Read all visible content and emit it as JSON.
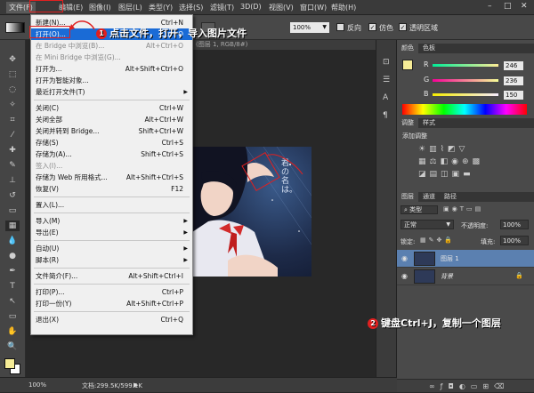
{
  "menubar": {
    "items": [
      "文件(F)",
      "编辑(E)",
      "图像(I)",
      "图层(L)",
      "类型(Y)",
      "选择(S)",
      "滤镜(T)",
      "3D(D)",
      "视图(V)",
      "窗口(W)",
      "帮助(H)"
    ],
    "window_controls": [
      "–",
      "□",
      "✕"
    ]
  },
  "options": {
    "opacity_value": "100%",
    "reverse_label": "反向",
    "dither_label": "仿色",
    "transparency_label": "透明区域"
  },
  "file_menu": {
    "items": [
      {
        "label": "新建(N)...",
        "shortcut": "Ctrl+N"
      },
      {
        "label": "打开(O)...",
        "shortcut": "Ctrl+O"
      },
      {
        "label": "在 Bridge 中浏览(B)...",
        "shortcut": "Alt+Ctrl+O"
      },
      {
        "label": "在 Mini Bridge 中浏览(G)...",
        "shortcut": ""
      },
      {
        "label": "打开为...",
        "shortcut": "Alt+Shift+Ctrl+O"
      },
      {
        "label": "打开为智能对象...",
        "shortcut": ""
      },
      {
        "label": "最近打开文件(T)",
        "shortcut": ""
      },
      {
        "label": "关闭(C)",
        "shortcut": "Ctrl+W"
      },
      {
        "label": "关闭全部",
        "shortcut": "Alt+Ctrl+W"
      },
      {
        "label": "关闭并转到 Bridge...",
        "shortcut": "Shift+Ctrl+W"
      },
      {
        "label": "存储(S)",
        "shortcut": "Ctrl+S"
      },
      {
        "label": "存储为(A)...",
        "shortcut": "Shift+Ctrl+S"
      },
      {
        "label": "签入(I)...",
        "shortcut": ""
      },
      {
        "label": "存储为 Web 所用格式...",
        "shortcut": "Alt+Shift+Ctrl+S"
      },
      {
        "label": "恢复(V)",
        "shortcut": "F12"
      },
      {
        "label": "置入(L)...",
        "shortcut": ""
      },
      {
        "label": "导入(M)",
        "shortcut": ""
      },
      {
        "label": "导出(E)",
        "shortcut": ""
      },
      {
        "label": "自动(U)",
        "shortcut": ""
      },
      {
        "label": "脚本(R)",
        "shortcut": ""
      },
      {
        "label": "文件简介(F)...",
        "shortcut": "Alt+Shift+Ctrl+I"
      },
      {
        "label": "打印(P)...",
        "shortcut": "Ctrl+P"
      },
      {
        "label": "打印一份(Y)",
        "shortcut": "Alt+Shift+Ctrl+P"
      },
      {
        "label": "退出(X)",
        "shortcut": "Ctrl+Q"
      }
    ]
  },
  "document": {
    "tab_title": "(图层 1, RGB/8#)",
    "canvas_text": "君の名は。"
  },
  "status": {
    "zoom": "100%",
    "doc_size": "文档:299.5K/599.1K"
  },
  "color_panel": {
    "tabs": [
      "颜色",
      "色板"
    ],
    "r_label": "R",
    "g_label": "G",
    "b_label": "B",
    "r_value": "246",
    "g_value": "236",
    "b_value": "150",
    "swatch_color": "#f6ec96"
  },
  "adjust_panel": {
    "tabs": [
      "调整",
      "样式"
    ],
    "title": "添加调整"
  },
  "layers_panel": {
    "tabs": [
      "图层",
      "通道",
      "路径"
    ],
    "kind_label": "类型",
    "blend_mode": "正常",
    "opacity_label": "不透明度:",
    "opacity_value": "100%",
    "lock_label": "锁定:",
    "fill_label": "填充:",
    "fill_value": "100%",
    "layers": [
      {
        "name": "图层 1"
      },
      {
        "name": "背景"
      }
    ]
  },
  "annotations": {
    "step1_num": "1",
    "step1_text": "点击文件，打开，导入图片文件",
    "step2_num": "2",
    "step2_text": "键盘Ctrl+J，复制一个图层"
  },
  "colors": {
    "menu_highlight": "#1a6bd6",
    "annotation_red": "#e02020",
    "selected_layer": "#5b80b0"
  }
}
